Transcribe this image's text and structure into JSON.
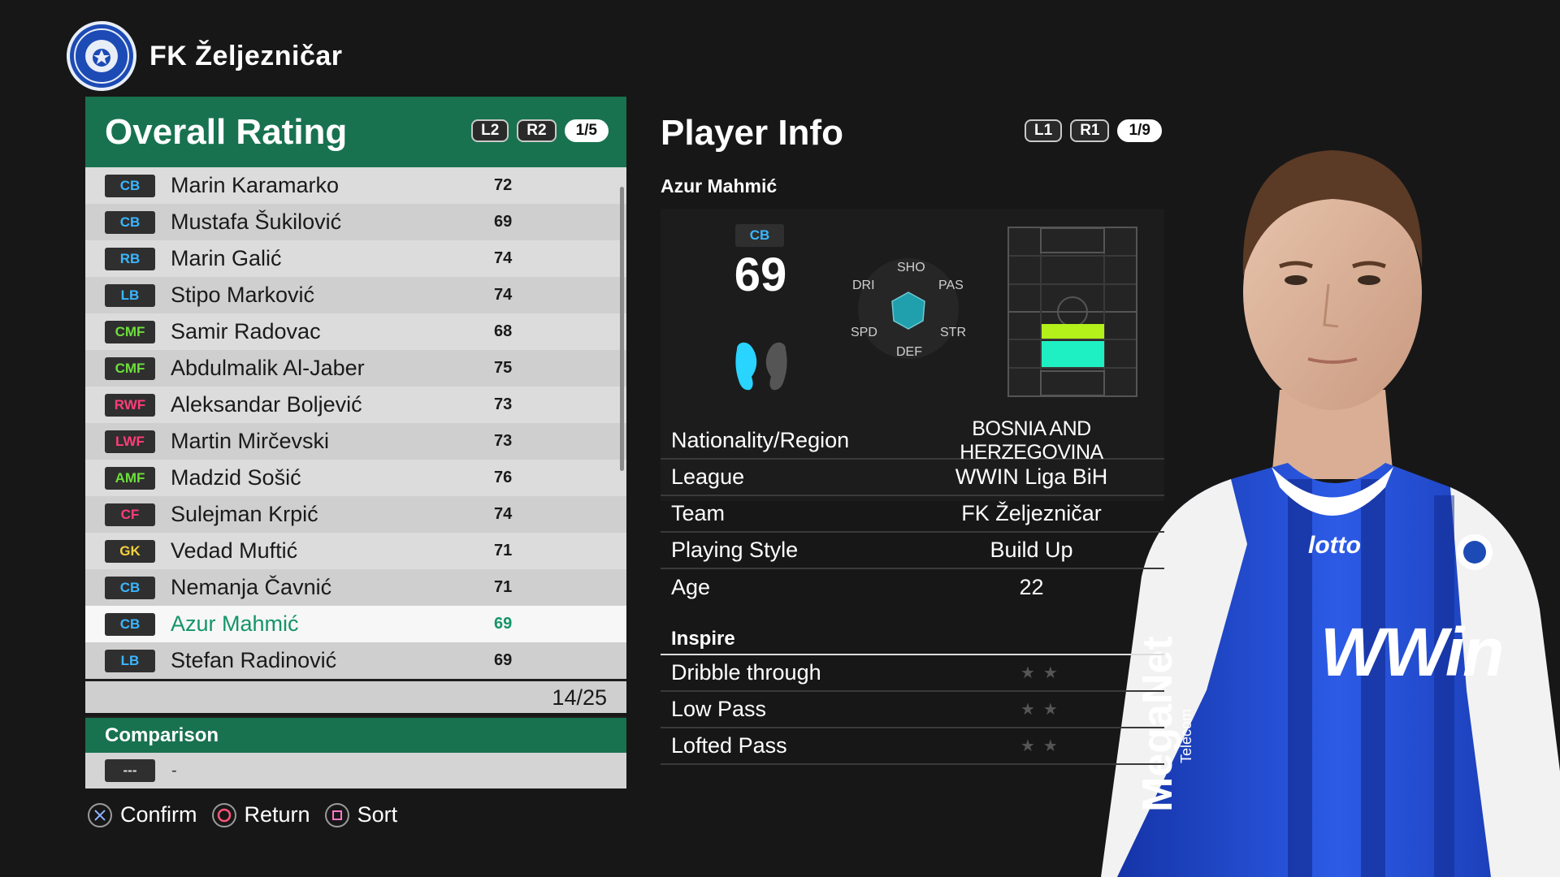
{
  "club": {
    "name": "FK Željezničar"
  },
  "left": {
    "title": "Overall Rating",
    "buttons": [
      "L2",
      "R2"
    ],
    "page": "1/5",
    "players": [
      {
        "pos": "CB",
        "pos_color": "#3ab6ff",
        "name": "Marin Karamarko",
        "rating": "72"
      },
      {
        "pos": "CB",
        "pos_color": "#3ab6ff",
        "name": "Mustafa Šukilović",
        "rating": "69"
      },
      {
        "pos": "RB",
        "pos_color": "#3ab6ff",
        "name": "Marin Galić",
        "rating": "74"
      },
      {
        "pos": "LB",
        "pos_color": "#3ab6ff",
        "name": "Stipo Marković",
        "rating": "74"
      },
      {
        "pos": "CMF",
        "pos_color": "#6ddf3c",
        "name": "Samir Radovac",
        "rating": "68"
      },
      {
        "pos": "CMF",
        "pos_color": "#6ddf3c",
        "name": "Abdulmalik Al-Jaber",
        "rating": "75"
      },
      {
        "pos": "RWF",
        "pos_color": "#ff3d7a",
        "name": "Aleksandar Boljević",
        "rating": "73"
      },
      {
        "pos": "LWF",
        "pos_color": "#ff3d7a",
        "name": "Martin Mirčevski",
        "rating": "73"
      },
      {
        "pos": "AMF",
        "pos_color": "#6ddf3c",
        "name": "Madzid Sošić",
        "rating": "76"
      },
      {
        "pos": "CF",
        "pos_color": "#ff3d7a",
        "name": "Sulejman Krpić",
        "rating": "74"
      },
      {
        "pos": "GK",
        "pos_color": "#f2d13a",
        "name": "Vedad Muftić",
        "rating": "71"
      },
      {
        "pos": "CB",
        "pos_color": "#3ab6ff",
        "name": "Nemanja Čavnić",
        "rating": "71"
      },
      {
        "pos": "CB",
        "pos_color": "#3ab6ff",
        "name": "Azur Mahmić",
        "rating": "69",
        "selected": true
      },
      {
        "pos": "LB",
        "pos_color": "#3ab6ff",
        "name": "Stefan Radinović",
        "rating": "69"
      }
    ],
    "count": "14/25",
    "comparison": {
      "title": "Comparison",
      "pos": "---",
      "name": "-"
    }
  },
  "controls": {
    "confirm": "Confirm",
    "return": "Return",
    "sort": "Sort"
  },
  "right": {
    "title": "Player Info",
    "buttons": [
      "L1",
      "R1"
    ],
    "page": "1/9",
    "player_name": "Azur Mahmić",
    "position": "CB",
    "rating": "69",
    "hex_labels": {
      "sho": "SHO",
      "pas": "PAS",
      "str": "STR",
      "def": "DEF",
      "spd": "SPD",
      "dri": "DRI"
    },
    "info": [
      {
        "label": "Nationality/Region",
        "value": "BOSNIA AND HERZEGOVINA"
      },
      {
        "label": "League",
        "value": "WWIN Liga BiH"
      },
      {
        "label": "Team",
        "value": "FK Željezničar"
      },
      {
        "label": "Playing Style",
        "value": "Build Up"
      },
      {
        "label": "Age",
        "value": "22"
      }
    ],
    "inspire_title": "Inspire",
    "inspire": [
      {
        "label": "Dribble through",
        "stars": "★★"
      },
      {
        "label": "Low Pass",
        "stars": "★★"
      },
      {
        "label": "Lofted Pass",
        "stars": "★★"
      }
    ]
  },
  "kit": {
    "brand": "lotto",
    "sponsor": "WWin",
    "sleeve_sponsor": "MegaNet",
    "sleeve_sub": "Telecom"
  }
}
